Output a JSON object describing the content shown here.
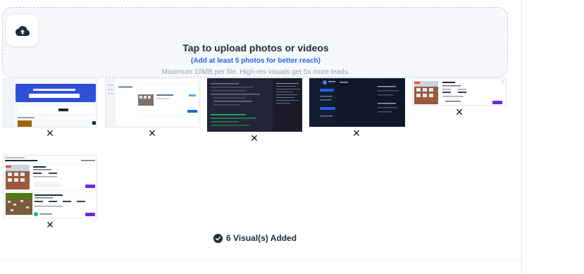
{
  "upload": {
    "icon": "cloud-upload-icon",
    "title": "Tap to upload photos or videos",
    "subtitle": "(Add at least 5 photos for better reach)",
    "hint": "Maximum 10MB per file. High-res visuals get 5x more leads."
  },
  "thumbnails": [
    {
      "content": "Screenshot of a property listing dashboard with blue banner",
      "remove_icon": "close-icon"
    },
    {
      "content": "Screenshot of a property details page with building image",
      "remove_icon": "close-icon"
    },
    {
      "content": "Dark code editor screenshot",
      "remove_icon": "close-icon"
    },
    {
      "content": "Dark settings page screenshot",
      "remove_icon": "close-icon"
    },
    {
      "content": "Property card with apartment building photo",
      "remove_icon": "close-icon"
    },
    {
      "content": "Properties for Sale listings page",
      "remove_icon": "close-icon"
    }
  ],
  "status": {
    "icon": "check-circle-icon",
    "label": "6 Visual(s) Added"
  },
  "colors": {
    "accent_blue": "#2563eb",
    "dark_navy": "#1e293b",
    "purple_button": "#6d28d9"
  }
}
